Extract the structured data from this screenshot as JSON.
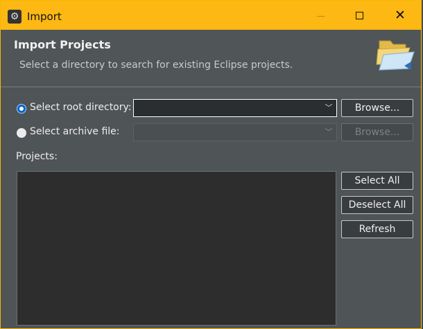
{
  "window": {
    "title": "Import",
    "controls": {
      "minimize": "–",
      "maximize": "□",
      "close": "✕"
    },
    "accent_color": "#fdb813"
  },
  "banner": {
    "title": "Import Projects",
    "description": "Select a directory to search for existing Eclipse projects.",
    "icon": "folder-import-icon"
  },
  "form": {
    "root_directory": {
      "label": "Select root directory:",
      "selected": true,
      "value": ""
    },
    "archive_file": {
      "label": "Select archive file:",
      "selected": false,
      "value": ""
    },
    "browse_label": "Browse...",
    "projects_label": "Projects:"
  },
  "actions": {
    "select_all": "Select All",
    "deselect_all": "Deselect All",
    "refresh": "Refresh"
  },
  "projects": []
}
